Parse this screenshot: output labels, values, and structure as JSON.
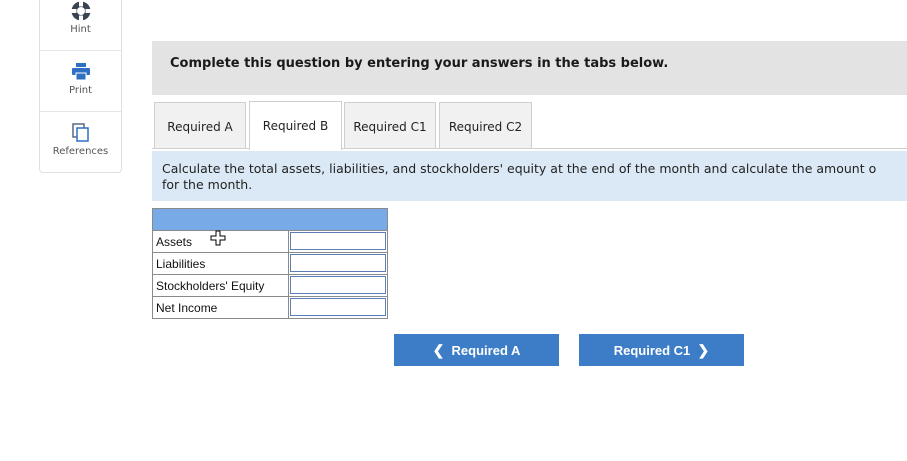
{
  "tools": {
    "hint_label": "Hint",
    "print_label": "Print",
    "references_label": "References"
  },
  "instruction": "Complete this question by entering your answers in the tabs below.",
  "tabs": [
    {
      "label": "Required A",
      "active": false
    },
    {
      "label": "Required B",
      "active": true
    },
    {
      "label": "Required C1",
      "active": false
    },
    {
      "label": "Required C2",
      "active": false
    }
  ],
  "question": {
    "line1": "Calculate the total assets, liabilities, and stockholders' equity at the end of the month and calculate the amount o",
    "line2": "for the month."
  },
  "table": {
    "header": "",
    "rows": [
      {
        "label": "Assets",
        "value": ""
      },
      {
        "label": "Liabilities",
        "value": ""
      },
      {
        "label": "Stockholders' Equity",
        "value": ""
      },
      {
        "label": "Net Income",
        "value": ""
      }
    ]
  },
  "nav": {
    "prev_label": "Required A",
    "next_label": "Required C1",
    "prev_icon": "chevron-left-icon",
    "next_icon": "chevron-right-icon"
  },
  "colors": {
    "button": "#3d7dc7",
    "table_header": "#79aae8",
    "question_bg": "#dbe9f6",
    "instruction_bg": "#e3e3e3"
  }
}
